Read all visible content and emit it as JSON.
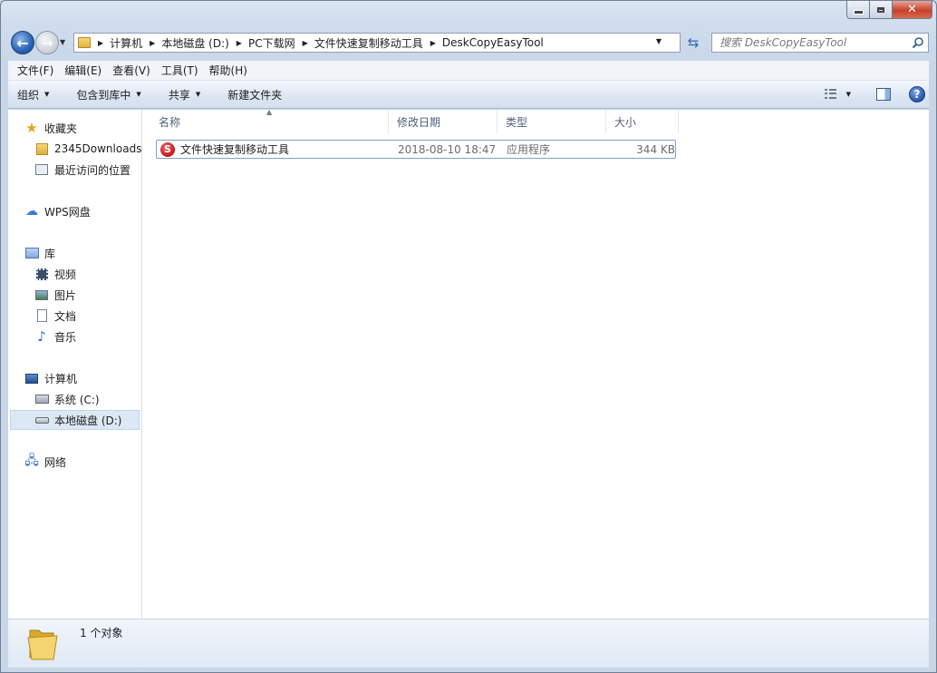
{
  "window": {
    "close_glyph": "✕"
  },
  "address": {
    "crumbs": [
      "计算机",
      "本地磁盘 (D:)",
      "PC下载网",
      "文件快速复制移动工具",
      "DeskCopyEasyTool"
    ]
  },
  "search": {
    "placeholder": "搜索 DeskCopyEasyTool"
  },
  "menu": {
    "items": [
      "文件(F)",
      "编辑(E)",
      "查看(V)",
      "工具(T)",
      "帮助(H)"
    ]
  },
  "toolbar": {
    "organize": "组织",
    "include_in_library": "包含到库中",
    "share": "共享",
    "new_folder": "新建文件夹",
    "help_glyph": "?"
  },
  "sidebar": {
    "favorites": {
      "label": "收藏夹",
      "items": [
        "2345Downloads",
        "最近访问的位置"
      ]
    },
    "wps": "WPS网盘",
    "libraries": {
      "label": "库",
      "items": [
        "视频",
        "图片",
        "文档",
        "音乐"
      ]
    },
    "computer": {
      "label": "计算机",
      "items": [
        "系统 (C:)",
        "本地磁盘 (D:)"
      ]
    },
    "network": "网络"
  },
  "file_list": {
    "columns": [
      "名称",
      "修改日期",
      "类型",
      "大小"
    ],
    "rows": [
      {
        "name": "文件快速复制移动工具",
        "modified": "2018-08-10 18:47",
        "type": "应用程序",
        "size": "344 KB"
      }
    ]
  },
  "status": {
    "count_text": "1 个对象"
  },
  "colors": {
    "accent": "#2a62b4",
    "selection_border": "#7da2ce",
    "app_icon_red": "#c3151a"
  }
}
